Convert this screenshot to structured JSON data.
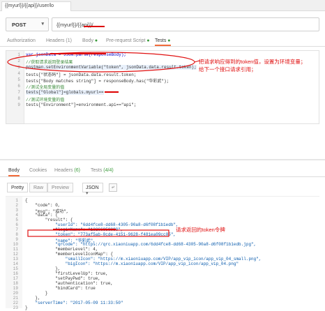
{
  "tab": {
    "title": "{{myurl}}/{{api}}/user/lo"
  },
  "request": {
    "method": "POST",
    "url": "{{myurl}}/{{api}}/"
  },
  "request_tabs": [
    {
      "label": "Authorization"
    },
    {
      "label": "Headers",
      "badge": "(1)"
    },
    {
      "label": "Body",
      "dot": "●"
    },
    {
      "label": "Pre-request Script",
      "dot": "●"
    },
    {
      "label": "Tests",
      "dot": "●"
    }
  ],
  "tests_code": [
    {
      "n": "1",
      "text": "var jsonData = JSON.parse(responseBody);"
    },
    {
      "n": "2",
      "text": "//获取请求返回登录结果"
    },
    {
      "n": "3",
      "text": "postman.setEnvironmentVariable(\"token\", jsonData.data.result.token);"
    },
    {
      "n": "4",
      "text": "tests[\"状态码\"] = jsonData.data.result.token;"
    },
    {
      "n": "5",
      "text": "tests[\"Body matches string\"] = responseBody.has(\"华彩武\");"
    },
    {
      "n": "6",
      "text": "//测试全局变量的值"
    },
    {
      "n": "7",
      "text": "tests[\"Global\"]=globals.myurl=="
    },
    {
      "n": "8",
      "text": "//测试环境变量的值"
    },
    {
      "n": "9",
      "text": "tests[\"Environment\"]=environment.api==\"api\";"
    }
  ],
  "annotations": {
    "tests_note_line1": "把请求响应得到的token值，设置为环境变量；",
    "tests_note_line2": "给下一个接口请求引用；",
    "response_note": "请求返回的token令牌"
  },
  "response_tabs": [
    {
      "label": "Body"
    },
    {
      "label": "Cookies"
    },
    {
      "label": "Headers",
      "badge": "(6)"
    },
    {
      "label": "Tests",
      "badge": "(4/4)"
    }
  ],
  "view_modes": [
    "Pretty",
    "Raw",
    "Preview"
  ],
  "format_select": "JSON",
  "response_json": [
    {
      "n": "1",
      "text": "{"
    },
    {
      "n": "2",
      "text": "    \"code\": 0,"
    },
    {
      "n": "3",
      "text": "    \"msg\": \"成功\","
    },
    {
      "n": "4",
      "text": "    \"data\": {"
    },
    {
      "n": "5",
      "text": "        \"result\": {"
    },
    {
      "n": "6",
      "text": "            \"userId\": \"6dd4fce8-dd68-4305-90a8-d6f08f1b1edb\","
    },
    {
      "n": "7",
      "text": "            \"loginName\": \"13266858088\","
    },
    {
      "n": "8",
      "text": "            \"token\": \"773af5ab-0cde-4151-9628-f481ea09cc05\","
    },
    {
      "n": "9",
      "text": "            \"name\": \"华彩武\","
    },
    {
      "n": "10",
      "text": "            \"qrCode\": \"https://qrc.xiaoniuapp.com/6dd4fce8-dd68-4305-90a8-d6f08f1b1edb.jpg\","
    },
    {
      "n": "11",
      "text": "            \"memberLevel\": 4,"
    },
    {
      "n": "12",
      "text": "            \"memberLevelIconMap\": {"
    },
    {
      "n": "13",
      "text": "                \"smallIcon\": \"https://m.xiaoniuapp.com/VIP/app_vip_icon/app_vip_04_small.png\","
    },
    {
      "n": "14",
      "text": "                \"bigIcon\": \"https://m.xiaoniuapp.com/VIP/app_vip_icon/app_vip_04.png\""
    },
    {
      "n": "15",
      "text": "            },"
    },
    {
      "n": "16",
      "text": "            \"firstLevelUp\": true,"
    },
    {
      "n": "17",
      "text": "            \"setPayPwd\": true,"
    },
    {
      "n": "18",
      "text": "            \"authentication\": true,"
    },
    {
      "n": "19",
      "text": "            \"bindCard\": true"
    },
    {
      "n": "20",
      "text": "        }"
    },
    {
      "n": "21",
      "text": "    },"
    },
    {
      "n": "22",
      "text": "    \"serverTime\": \"2017-05-09 11:33:50\""
    },
    {
      "n": "23",
      "text": "}"
    }
  ],
  "colors": {
    "accent": "#f26b3a",
    "annotation": "#e01010",
    "green": "#3a9a3a"
  }
}
